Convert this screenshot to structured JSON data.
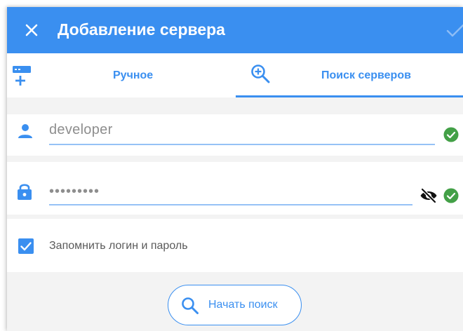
{
  "colors": {
    "primary": "#3a8ff0",
    "success": "#43a047",
    "surface": "#ffffff",
    "background": "#f3f3f3"
  },
  "appbar": {
    "title": "Добавление сервера",
    "close_icon": "close-icon",
    "confirm_icon": "check-icon"
  },
  "tabs": [
    {
      "label": "Ручное",
      "icon": "server-add-icon",
      "selected": false
    },
    {
      "label": "Поиск серверов",
      "icon": "zoom-in-icon",
      "selected": true
    }
  ],
  "form": {
    "username": {
      "icon": "person-icon",
      "value": "developer",
      "status_icon": "check-circle-icon"
    },
    "password": {
      "icon": "lock-icon",
      "value": "developer",
      "masked": true,
      "visibility_icon": "eye-off-icon",
      "status_icon": "check-circle-icon"
    },
    "remember": {
      "label": "Запомнить логин и пароль",
      "checked": true
    }
  },
  "search_button": {
    "label": "Начать поиск",
    "icon": "search-icon"
  }
}
